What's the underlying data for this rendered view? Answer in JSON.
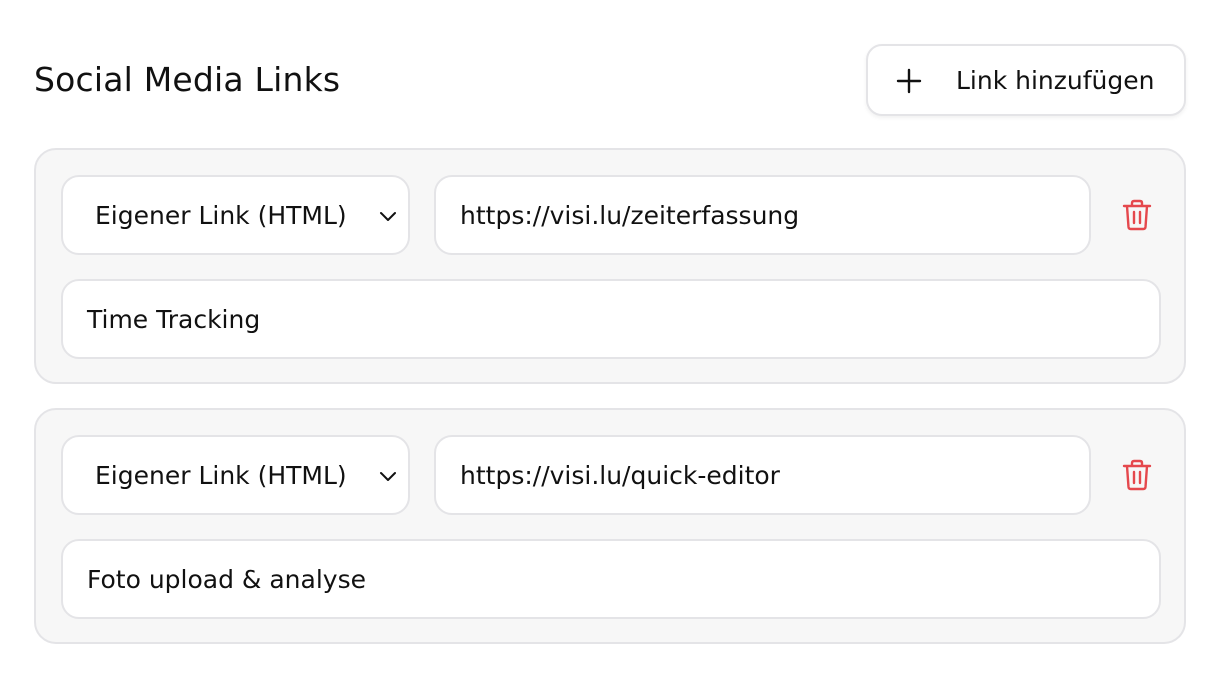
{
  "section": {
    "title": "Social Media Links",
    "add_button_label": "Link hinzufügen"
  },
  "links": [
    {
      "type": "Eigener Link (HTML)",
      "url": "https://visi.lu/zeiterfassung",
      "label": "Time Tracking"
    },
    {
      "type": "Eigener Link (HTML)",
      "url": "https://visi.lu/quick-editor",
      "label": "Foto upload & analyse"
    }
  ],
  "icons": {
    "add": "plus-icon",
    "dropdown": "chevron-down-icon",
    "delete": "trash-icon"
  },
  "colors": {
    "delete": "#e5484d",
    "card_background": "#f7f7f7",
    "border": "#e4e4e7"
  }
}
